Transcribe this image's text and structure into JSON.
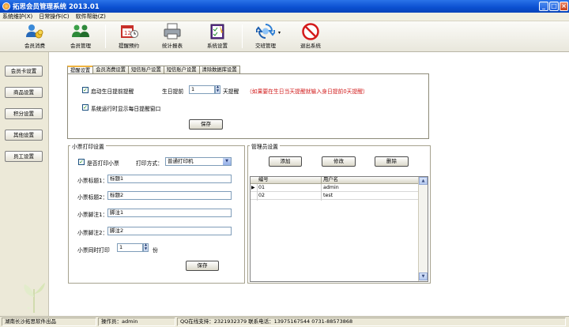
{
  "window": {
    "title": "拓思会员管理系统 2013.01"
  },
  "menu": [
    "系统维护(X)",
    "日常操作(C)",
    "软件帮助(Z)"
  ],
  "toolbar": [
    {
      "label": "会员消费",
      "icon": "users-coins-icon"
    },
    {
      "label": "会员管理",
      "icon": "users-group-icon"
    },
    {
      "label": "提醒预约",
      "icon": "calendar-reminder-icon"
    },
    {
      "label": "统计报表",
      "icon": "printer-report-icon"
    },
    {
      "label": "系统设置",
      "icon": "settings-checklist-icon"
    },
    {
      "label": "交班管理",
      "icon": "shift-exchange-icon"
    },
    {
      "label": "退出系统",
      "icon": "exit-no-entry-icon"
    }
  ],
  "sidebar": [
    "会员卡设置",
    "商品设置",
    "积分设置",
    "其他设置",
    "员工设置"
  ],
  "tabs": [
    "提醒设置",
    "会员消费设置",
    "短信账户设置",
    "短信账户设置",
    "清除数据库设置"
  ],
  "reminder": {
    "enable_label": "启动生日提前提醒",
    "days_before_label": "生日提前",
    "days_value": "1",
    "days_suffix": "天提醒",
    "hint": "（如果要在生日当天提醒就输入身日提前0天提醒）",
    "daily_popup_label": "系统运行时显示每日提醒窗口",
    "save": "保存"
  },
  "receipt": {
    "title": "小票打印设置",
    "print_label": "是否打印小票",
    "mode_label": "打印方式：",
    "mode_value": "普通打印机",
    "title1_label": "小票标题1：",
    "title1_value": "标题1",
    "title2_label": "小票标题2：",
    "title2_value": "标题2",
    "footer1_label": "小票脚注1：",
    "footer1_value": "脚注1",
    "footer2_label": "小票脚注2：",
    "footer2_value": "脚注2",
    "copies_label": "小票同时打印",
    "copies_value": "1",
    "copies_suffix": "份",
    "save": "保存"
  },
  "admin": {
    "title": "管理员设置",
    "add": "添加",
    "edit": "修改",
    "delete": "删除",
    "columns": [
      "编号",
      "用户名"
    ],
    "rows": [
      [
        "01",
        "admin"
      ],
      [
        "02",
        "test"
      ]
    ]
  },
  "status": {
    "company": "湖南长沙拓思软件出品",
    "operator": "操作员：admin",
    "contact": "QQ在线支持：2321932379   联系电话：13975167544   0731-88573868"
  },
  "colors": {
    "title_blue": "#0a4fd0",
    "hint_red": "#d11a1a",
    "tab_accent": "#f0b440"
  }
}
